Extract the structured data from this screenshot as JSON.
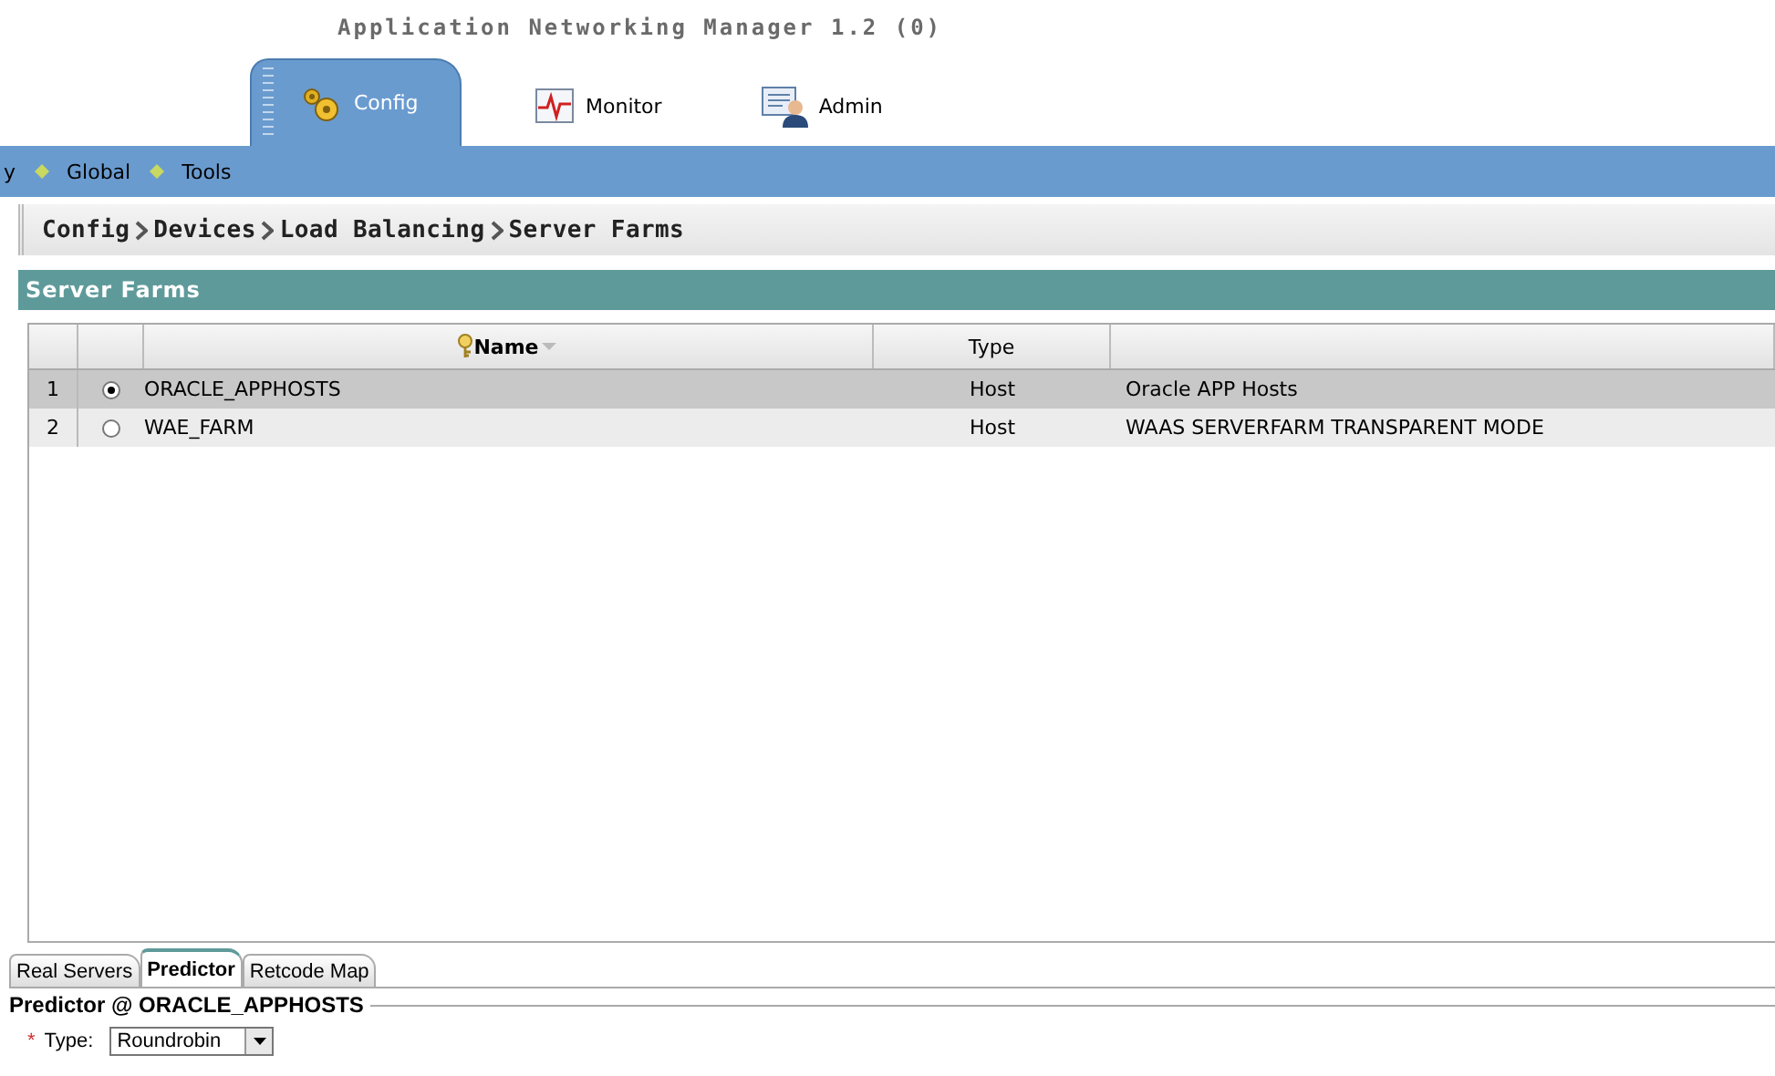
{
  "window": {
    "title": "Application Networking Manager 1.2 (0)"
  },
  "tabs": [
    {
      "label": "Config",
      "selected": true
    },
    {
      "label": "Monitor",
      "selected": false
    },
    {
      "label": "Admin",
      "selected": false
    }
  ],
  "nav_items": [
    "y",
    "Global",
    "Tools"
  ],
  "breadcrumb": [
    "Config",
    "Devices",
    "Load Balancing",
    "Server Farms"
  ],
  "panel": {
    "title": "Server Farms",
    "columns": [
      {
        "label": "Name"
      },
      {
        "label": "Type"
      }
    ],
    "rows": [
      {
        "number": "1",
        "name": "ORACLE_APPHOSTS",
        "type": "Host",
        "description": "Oracle APP Hosts",
        "selected": true
      },
      {
        "number": "2",
        "name": "WAE_FARM",
        "type": "Host",
        "description": "WAAS SERVERFARM TRANSPARENT MODE",
        "selected": false
      }
    ]
  },
  "detail_tabs": [
    {
      "label": "Real Servers",
      "selected": false
    },
    {
      "label": "Predictor",
      "selected": true
    },
    {
      "label": "Retcode Map",
      "selected": false
    }
  ],
  "detail": {
    "legend": "Predictor @ ORACLE_APPHOSTS",
    "field": {
      "required_mark": "*",
      "label": "Type:",
      "value": "Roundrobin"
    }
  }
}
